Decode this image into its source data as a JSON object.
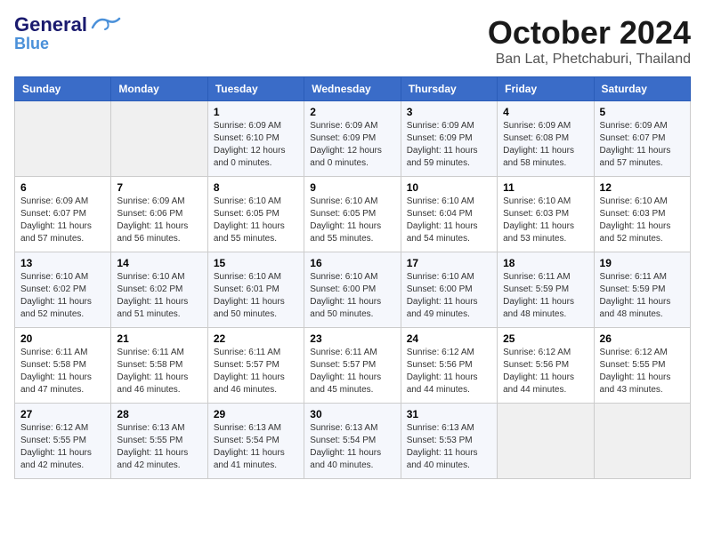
{
  "header": {
    "logo_line1": "General",
    "logo_line2": "Blue",
    "month": "October 2024",
    "location": "Ban Lat, Phetchaburi, Thailand"
  },
  "days_of_week": [
    "Sunday",
    "Monday",
    "Tuesday",
    "Wednesday",
    "Thursday",
    "Friday",
    "Saturday"
  ],
  "weeks": [
    [
      {
        "day": "",
        "sunrise": "",
        "sunset": "",
        "daylight": ""
      },
      {
        "day": "",
        "sunrise": "",
        "sunset": "",
        "daylight": ""
      },
      {
        "day": "1",
        "sunrise": "Sunrise: 6:09 AM",
        "sunset": "Sunset: 6:10 PM",
        "daylight": "Daylight: 12 hours and 0 minutes."
      },
      {
        "day": "2",
        "sunrise": "Sunrise: 6:09 AM",
        "sunset": "Sunset: 6:09 PM",
        "daylight": "Daylight: 12 hours and 0 minutes."
      },
      {
        "day": "3",
        "sunrise": "Sunrise: 6:09 AM",
        "sunset": "Sunset: 6:09 PM",
        "daylight": "Daylight: 11 hours and 59 minutes."
      },
      {
        "day": "4",
        "sunrise": "Sunrise: 6:09 AM",
        "sunset": "Sunset: 6:08 PM",
        "daylight": "Daylight: 11 hours and 58 minutes."
      },
      {
        "day": "5",
        "sunrise": "Sunrise: 6:09 AM",
        "sunset": "Sunset: 6:07 PM",
        "daylight": "Daylight: 11 hours and 57 minutes."
      }
    ],
    [
      {
        "day": "6",
        "sunrise": "Sunrise: 6:09 AM",
        "sunset": "Sunset: 6:07 PM",
        "daylight": "Daylight: 11 hours and 57 minutes."
      },
      {
        "day": "7",
        "sunrise": "Sunrise: 6:09 AM",
        "sunset": "Sunset: 6:06 PM",
        "daylight": "Daylight: 11 hours and 56 minutes."
      },
      {
        "day": "8",
        "sunrise": "Sunrise: 6:10 AM",
        "sunset": "Sunset: 6:05 PM",
        "daylight": "Daylight: 11 hours and 55 minutes."
      },
      {
        "day": "9",
        "sunrise": "Sunrise: 6:10 AM",
        "sunset": "Sunset: 6:05 PM",
        "daylight": "Daylight: 11 hours and 55 minutes."
      },
      {
        "day": "10",
        "sunrise": "Sunrise: 6:10 AM",
        "sunset": "Sunset: 6:04 PM",
        "daylight": "Daylight: 11 hours and 54 minutes."
      },
      {
        "day": "11",
        "sunrise": "Sunrise: 6:10 AM",
        "sunset": "Sunset: 6:03 PM",
        "daylight": "Daylight: 11 hours and 53 minutes."
      },
      {
        "day": "12",
        "sunrise": "Sunrise: 6:10 AM",
        "sunset": "Sunset: 6:03 PM",
        "daylight": "Daylight: 11 hours and 52 minutes."
      }
    ],
    [
      {
        "day": "13",
        "sunrise": "Sunrise: 6:10 AM",
        "sunset": "Sunset: 6:02 PM",
        "daylight": "Daylight: 11 hours and 52 minutes."
      },
      {
        "day": "14",
        "sunrise": "Sunrise: 6:10 AM",
        "sunset": "Sunset: 6:02 PM",
        "daylight": "Daylight: 11 hours and 51 minutes."
      },
      {
        "day": "15",
        "sunrise": "Sunrise: 6:10 AM",
        "sunset": "Sunset: 6:01 PM",
        "daylight": "Daylight: 11 hours and 50 minutes."
      },
      {
        "day": "16",
        "sunrise": "Sunrise: 6:10 AM",
        "sunset": "Sunset: 6:00 PM",
        "daylight": "Daylight: 11 hours and 50 minutes."
      },
      {
        "day": "17",
        "sunrise": "Sunrise: 6:10 AM",
        "sunset": "Sunset: 6:00 PM",
        "daylight": "Daylight: 11 hours and 49 minutes."
      },
      {
        "day": "18",
        "sunrise": "Sunrise: 6:11 AM",
        "sunset": "Sunset: 5:59 PM",
        "daylight": "Daylight: 11 hours and 48 minutes."
      },
      {
        "day": "19",
        "sunrise": "Sunrise: 6:11 AM",
        "sunset": "Sunset: 5:59 PM",
        "daylight": "Daylight: 11 hours and 48 minutes."
      }
    ],
    [
      {
        "day": "20",
        "sunrise": "Sunrise: 6:11 AM",
        "sunset": "Sunset: 5:58 PM",
        "daylight": "Daylight: 11 hours and 47 minutes."
      },
      {
        "day": "21",
        "sunrise": "Sunrise: 6:11 AM",
        "sunset": "Sunset: 5:58 PM",
        "daylight": "Daylight: 11 hours and 46 minutes."
      },
      {
        "day": "22",
        "sunrise": "Sunrise: 6:11 AM",
        "sunset": "Sunset: 5:57 PM",
        "daylight": "Daylight: 11 hours and 46 minutes."
      },
      {
        "day": "23",
        "sunrise": "Sunrise: 6:11 AM",
        "sunset": "Sunset: 5:57 PM",
        "daylight": "Daylight: 11 hours and 45 minutes."
      },
      {
        "day": "24",
        "sunrise": "Sunrise: 6:12 AM",
        "sunset": "Sunset: 5:56 PM",
        "daylight": "Daylight: 11 hours and 44 minutes."
      },
      {
        "day": "25",
        "sunrise": "Sunrise: 6:12 AM",
        "sunset": "Sunset: 5:56 PM",
        "daylight": "Daylight: 11 hours and 44 minutes."
      },
      {
        "day": "26",
        "sunrise": "Sunrise: 6:12 AM",
        "sunset": "Sunset: 5:55 PM",
        "daylight": "Daylight: 11 hours and 43 minutes."
      }
    ],
    [
      {
        "day": "27",
        "sunrise": "Sunrise: 6:12 AM",
        "sunset": "Sunset: 5:55 PM",
        "daylight": "Daylight: 11 hours and 42 minutes."
      },
      {
        "day": "28",
        "sunrise": "Sunrise: 6:13 AM",
        "sunset": "Sunset: 5:55 PM",
        "daylight": "Daylight: 11 hours and 42 minutes."
      },
      {
        "day": "29",
        "sunrise": "Sunrise: 6:13 AM",
        "sunset": "Sunset: 5:54 PM",
        "daylight": "Daylight: 11 hours and 41 minutes."
      },
      {
        "day": "30",
        "sunrise": "Sunrise: 6:13 AM",
        "sunset": "Sunset: 5:54 PM",
        "daylight": "Daylight: 11 hours and 40 minutes."
      },
      {
        "day": "31",
        "sunrise": "Sunrise: 6:13 AM",
        "sunset": "Sunset: 5:53 PM",
        "daylight": "Daylight: 11 hours and 40 minutes."
      },
      {
        "day": "",
        "sunrise": "",
        "sunset": "",
        "daylight": ""
      },
      {
        "day": "",
        "sunrise": "",
        "sunset": "",
        "daylight": ""
      }
    ]
  ]
}
